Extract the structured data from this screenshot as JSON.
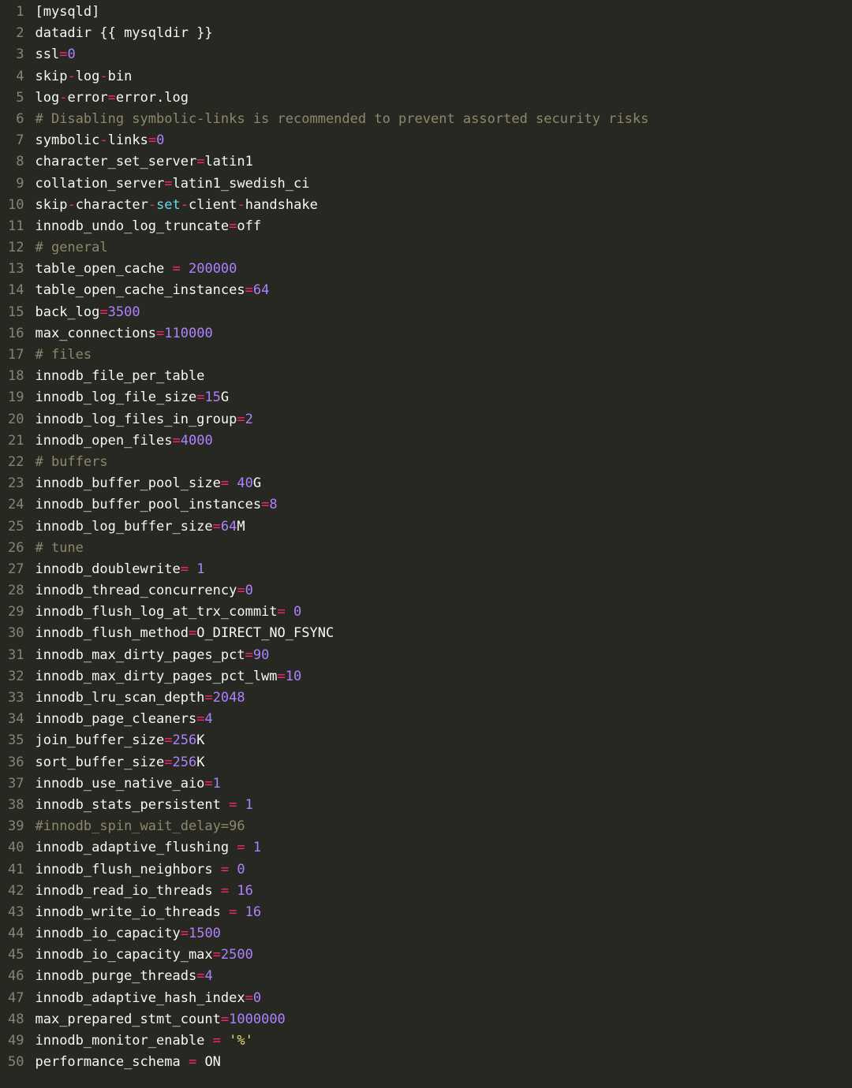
{
  "colors": {
    "bg": "#272822",
    "fg": "#f8f8f2",
    "gutter": "#868575",
    "red": "#f92672",
    "purple": "#ae81ff",
    "cyan": "#66d9ef",
    "comment": "#8e886b",
    "string": "#e6db74"
  },
  "lines": [
    {
      "n": 1,
      "tokens": [
        [
          "[mysqld]",
          "default"
        ]
      ]
    },
    {
      "n": 2,
      "tokens": [
        [
          "datadir {{ mysqldir }}",
          "default"
        ]
      ]
    },
    {
      "n": 3,
      "tokens": [
        [
          "ssl",
          "default"
        ],
        [
          "=",
          "op"
        ],
        [
          "0",
          "num"
        ]
      ]
    },
    {
      "n": 4,
      "tokens": [
        [
          "skip",
          "default"
        ],
        [
          "-",
          "op"
        ],
        [
          "log",
          "default"
        ],
        [
          "-",
          "op"
        ],
        [
          "bin",
          "default"
        ]
      ]
    },
    {
      "n": 5,
      "tokens": [
        [
          "log",
          "default"
        ],
        [
          "-",
          "op"
        ],
        [
          "error",
          "default"
        ],
        [
          "=",
          "op"
        ],
        [
          "error.log",
          "default"
        ]
      ]
    },
    {
      "n": 6,
      "tokens": [
        [
          "# Disabling symbolic-links is recommended to prevent assorted security risks",
          "comment"
        ]
      ]
    },
    {
      "n": 7,
      "tokens": [
        [
          "symbolic",
          "default"
        ],
        [
          "-",
          "op"
        ],
        [
          "links",
          "default"
        ],
        [
          "=",
          "op"
        ],
        [
          "0",
          "num"
        ]
      ]
    },
    {
      "n": 8,
      "tokens": [
        [
          "character_set_server",
          "default"
        ],
        [
          "=",
          "op"
        ],
        [
          "latin1",
          "default"
        ]
      ]
    },
    {
      "n": 9,
      "tokens": [
        [
          "collation_server",
          "default"
        ],
        [
          "=",
          "op"
        ],
        [
          "latin1_swedish_ci",
          "default"
        ]
      ]
    },
    {
      "n": 10,
      "tokens": [
        [
          "skip",
          "default"
        ],
        [
          "-",
          "op"
        ],
        [
          "character",
          "default"
        ],
        [
          "-",
          "op"
        ],
        [
          "set",
          "kw"
        ],
        [
          "-",
          "op"
        ],
        [
          "client",
          "default"
        ],
        [
          "-",
          "op"
        ],
        [
          "handshake",
          "default"
        ]
      ]
    },
    {
      "n": 11,
      "tokens": [
        [
          "innodb_undo_log_truncate",
          "default"
        ],
        [
          "=",
          "op"
        ],
        [
          "off",
          "default"
        ]
      ]
    },
    {
      "n": 12,
      "tokens": [
        [
          "# general",
          "comment"
        ]
      ]
    },
    {
      "n": 13,
      "tokens": [
        [
          "table_open_cache ",
          "default"
        ],
        [
          "=",
          "op"
        ],
        [
          " ",
          "default"
        ],
        [
          "200000",
          "num"
        ]
      ]
    },
    {
      "n": 14,
      "tokens": [
        [
          "table_open_cache_instances",
          "default"
        ],
        [
          "=",
          "op"
        ],
        [
          "64",
          "num"
        ]
      ]
    },
    {
      "n": 15,
      "tokens": [
        [
          "back_log",
          "default"
        ],
        [
          "=",
          "op"
        ],
        [
          "3500",
          "num"
        ]
      ]
    },
    {
      "n": 16,
      "tokens": [
        [
          "max_connections",
          "default"
        ],
        [
          "=",
          "op"
        ],
        [
          "110000",
          "num"
        ]
      ]
    },
    {
      "n": 17,
      "tokens": [
        [
          "# files",
          "comment"
        ]
      ]
    },
    {
      "n": 18,
      "tokens": [
        [
          "innodb_file_per_table",
          "default"
        ]
      ]
    },
    {
      "n": 19,
      "tokens": [
        [
          "innodb_log_file_size",
          "default"
        ],
        [
          "=",
          "op"
        ],
        [
          "15",
          "num"
        ],
        [
          "G",
          "default"
        ]
      ]
    },
    {
      "n": 20,
      "tokens": [
        [
          "innodb_log_files_in_group",
          "default"
        ],
        [
          "=",
          "op"
        ],
        [
          "2",
          "num"
        ]
      ]
    },
    {
      "n": 21,
      "tokens": [
        [
          "innodb_open_files",
          "default"
        ],
        [
          "=",
          "op"
        ],
        [
          "4000",
          "num"
        ]
      ]
    },
    {
      "n": 22,
      "tokens": [
        [
          "# buffers",
          "comment"
        ]
      ]
    },
    {
      "n": 23,
      "tokens": [
        [
          "innodb_buffer_pool_size",
          "default"
        ],
        [
          "=",
          "op"
        ],
        [
          " ",
          "default"
        ],
        [
          "40",
          "num"
        ],
        [
          "G",
          "default"
        ]
      ]
    },
    {
      "n": 24,
      "tokens": [
        [
          "innodb_buffer_pool_instances",
          "default"
        ],
        [
          "=",
          "op"
        ],
        [
          "8",
          "num"
        ]
      ]
    },
    {
      "n": 25,
      "tokens": [
        [
          "innodb_log_buffer_size",
          "default"
        ],
        [
          "=",
          "op"
        ],
        [
          "64",
          "num"
        ],
        [
          "M",
          "default"
        ]
      ]
    },
    {
      "n": 26,
      "tokens": [
        [
          "# tune",
          "comment"
        ]
      ]
    },
    {
      "n": 27,
      "tokens": [
        [
          "innodb_doublewrite",
          "default"
        ],
        [
          "=",
          "op"
        ],
        [
          " ",
          "default"
        ],
        [
          "1",
          "num"
        ]
      ]
    },
    {
      "n": 28,
      "tokens": [
        [
          "innodb_thread_concurrency",
          "default"
        ],
        [
          "=",
          "op"
        ],
        [
          "0",
          "num"
        ]
      ]
    },
    {
      "n": 29,
      "tokens": [
        [
          "innodb_flush_log_at_trx_commit",
          "default"
        ],
        [
          "=",
          "op"
        ],
        [
          " ",
          "default"
        ],
        [
          "0",
          "num"
        ]
      ]
    },
    {
      "n": 30,
      "tokens": [
        [
          "innodb_flush_method",
          "default"
        ],
        [
          "=",
          "op"
        ],
        [
          "O_DIRECT_NO_FSYNC",
          "default"
        ]
      ]
    },
    {
      "n": 31,
      "tokens": [
        [
          "innodb_max_dirty_pages_pct",
          "default"
        ],
        [
          "=",
          "op"
        ],
        [
          "90",
          "num"
        ]
      ]
    },
    {
      "n": 32,
      "tokens": [
        [
          "innodb_max_dirty_pages_pct_lwm",
          "default"
        ],
        [
          "=",
          "op"
        ],
        [
          "10",
          "num"
        ]
      ]
    },
    {
      "n": 33,
      "tokens": [
        [
          "innodb_lru_scan_depth",
          "default"
        ],
        [
          "=",
          "op"
        ],
        [
          "2048",
          "num"
        ]
      ]
    },
    {
      "n": 34,
      "tokens": [
        [
          "innodb_page_cleaners",
          "default"
        ],
        [
          "=",
          "op"
        ],
        [
          "4",
          "num"
        ]
      ]
    },
    {
      "n": 35,
      "tokens": [
        [
          "join_buffer_size",
          "default"
        ],
        [
          "=",
          "op"
        ],
        [
          "256",
          "num"
        ],
        [
          "K",
          "default"
        ]
      ]
    },
    {
      "n": 36,
      "tokens": [
        [
          "sort_buffer_size",
          "default"
        ],
        [
          "=",
          "op"
        ],
        [
          "256",
          "num"
        ],
        [
          "K",
          "default"
        ]
      ]
    },
    {
      "n": 37,
      "tokens": [
        [
          "innodb_use_native_aio",
          "default"
        ],
        [
          "=",
          "op"
        ],
        [
          "1",
          "num"
        ]
      ]
    },
    {
      "n": 38,
      "tokens": [
        [
          "innodb_stats_persistent ",
          "default"
        ],
        [
          "=",
          "op"
        ],
        [
          " ",
          "default"
        ],
        [
          "1",
          "num"
        ]
      ]
    },
    {
      "n": 39,
      "tokens": [
        [
          "#innodb_spin_wait_delay=96",
          "comment"
        ]
      ]
    },
    {
      "n": 40,
      "tokens": [
        [
          "innodb_adaptive_flushing ",
          "default"
        ],
        [
          "=",
          "op"
        ],
        [
          " ",
          "default"
        ],
        [
          "1",
          "num"
        ]
      ]
    },
    {
      "n": 41,
      "tokens": [
        [
          "innodb_flush_neighbors ",
          "default"
        ],
        [
          "=",
          "op"
        ],
        [
          " ",
          "default"
        ],
        [
          "0",
          "num"
        ]
      ]
    },
    {
      "n": 42,
      "tokens": [
        [
          "innodb_read_io_threads ",
          "default"
        ],
        [
          "=",
          "op"
        ],
        [
          " ",
          "default"
        ],
        [
          "16",
          "num"
        ]
      ]
    },
    {
      "n": 43,
      "tokens": [
        [
          "innodb_write_io_threads ",
          "default"
        ],
        [
          "=",
          "op"
        ],
        [
          " ",
          "default"
        ],
        [
          "16",
          "num"
        ]
      ]
    },
    {
      "n": 44,
      "tokens": [
        [
          "innodb_io_capacity",
          "default"
        ],
        [
          "=",
          "op"
        ],
        [
          "1500",
          "num"
        ]
      ]
    },
    {
      "n": 45,
      "tokens": [
        [
          "innodb_io_capacity_max",
          "default"
        ],
        [
          "=",
          "op"
        ],
        [
          "2500",
          "num"
        ]
      ]
    },
    {
      "n": 46,
      "tokens": [
        [
          "innodb_purge_threads",
          "default"
        ],
        [
          "=",
          "op"
        ],
        [
          "4",
          "num"
        ]
      ]
    },
    {
      "n": 47,
      "tokens": [
        [
          "innodb_adaptive_hash_index",
          "default"
        ],
        [
          "=",
          "op"
        ],
        [
          "0",
          "num"
        ]
      ]
    },
    {
      "n": 48,
      "tokens": [
        [
          "max_prepared_stmt_count",
          "default"
        ],
        [
          "=",
          "op"
        ],
        [
          "1000000",
          "num"
        ]
      ]
    },
    {
      "n": 49,
      "tokens": [
        [
          "innodb_monitor_enable ",
          "default"
        ],
        [
          "=",
          "op"
        ],
        [
          " ",
          "default"
        ],
        [
          "'%'",
          "str"
        ]
      ]
    },
    {
      "n": 50,
      "tokens": [
        [
          "performance_schema ",
          "default"
        ],
        [
          "=",
          "op"
        ],
        [
          " ON",
          "default"
        ]
      ]
    }
  ]
}
